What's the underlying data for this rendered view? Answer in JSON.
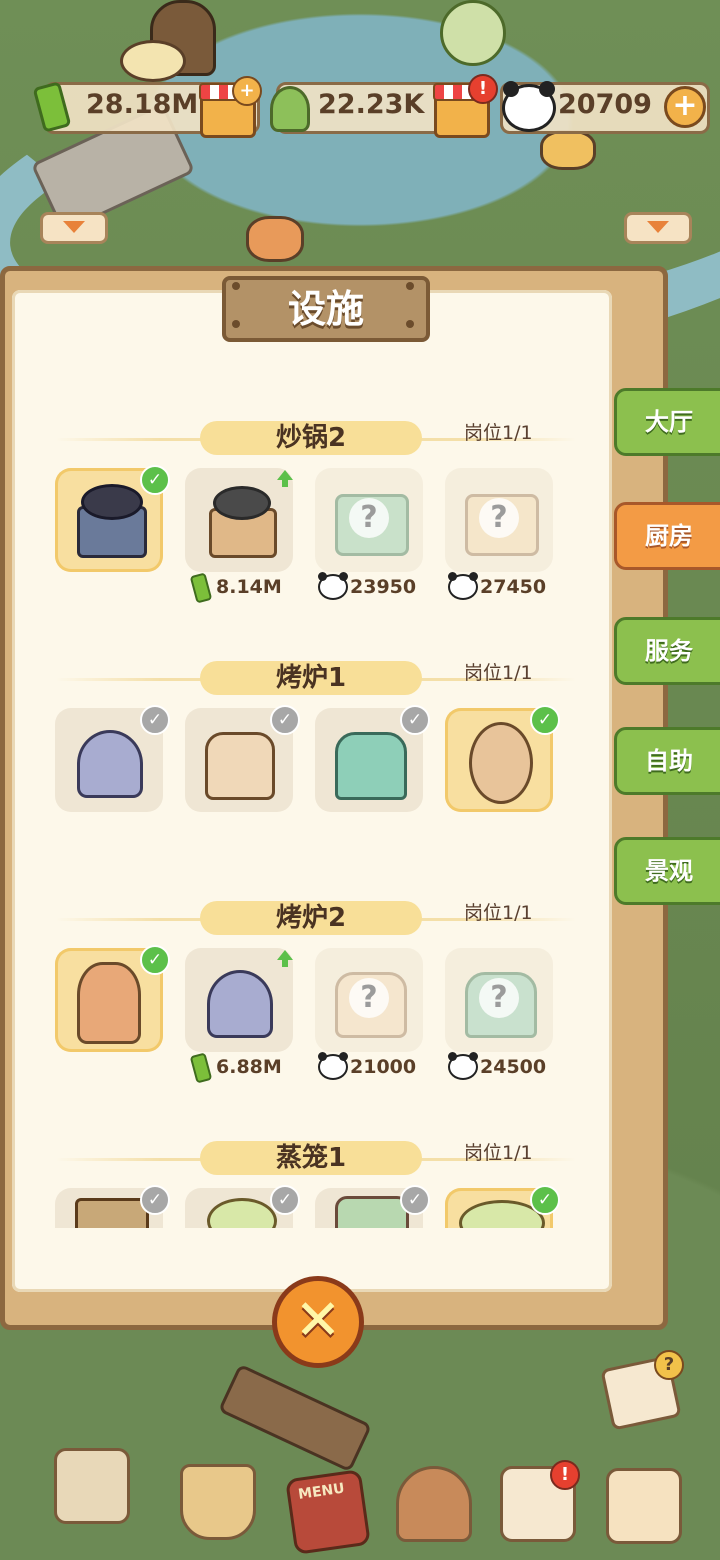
{
  "resources": {
    "bamboo": "28.18M",
    "coins": "22.23K",
    "pandas": "20709"
  },
  "panel": {
    "title": "设施"
  },
  "side_tabs": [
    {
      "label": "大厅",
      "active": false
    },
    {
      "label": "厨房",
      "active": true
    },
    {
      "label": "服务",
      "active": false
    },
    {
      "label": "自助",
      "active": false
    },
    {
      "label": "景观",
      "active": false
    }
  ],
  "sections": [
    {
      "name": "炒锅2",
      "slot": "岗位1/1",
      "items": [
        {
          "state": "selected",
          "badge": "check-green"
        },
        {
          "state": "owned",
          "badge": "upgrade",
          "cost": "8.14M",
          "currency": "bamboo"
        },
        {
          "state": "locked",
          "cost": "23950",
          "currency": "panda"
        },
        {
          "state": "locked",
          "cost": "27450",
          "currency": "panda"
        }
      ]
    },
    {
      "name": "烤炉1",
      "slot": "岗位1/1",
      "items": [
        {
          "state": "owned",
          "badge": "check-grey"
        },
        {
          "state": "owned",
          "badge": "check-grey"
        },
        {
          "state": "owned",
          "badge": "check-grey"
        },
        {
          "state": "selected",
          "badge": "check-green"
        }
      ]
    },
    {
      "name": "烤炉2",
      "slot": "岗位1/1",
      "items": [
        {
          "state": "selected",
          "badge": "check-green"
        },
        {
          "state": "owned",
          "badge": "upgrade",
          "cost": "6.88M",
          "currency": "bamboo"
        },
        {
          "state": "locked",
          "cost": "21000",
          "currency": "panda"
        },
        {
          "state": "locked",
          "cost": "24500",
          "currency": "panda"
        }
      ]
    },
    {
      "name": "蒸笼1",
      "slot": "岗位1/1",
      "items": [
        {
          "state": "owned",
          "badge": "check-grey"
        },
        {
          "state": "owned",
          "badge": "check-grey"
        },
        {
          "state": "owned",
          "badge": "check-grey"
        },
        {
          "state": "selected",
          "badge": "check-green"
        }
      ]
    }
  ],
  "icons": {
    "check": "✓",
    "question": "?",
    "close": "✕",
    "plus": "+",
    "alert": "!"
  },
  "bottom_toolbar": [
    "map-icon",
    "paint-bucket-icon",
    "menu-book-icon",
    "mushroom-icon",
    "panda-badge-icon",
    "shop-box-icon"
  ],
  "decor": {
    "menu_book_text": "MENU"
  }
}
